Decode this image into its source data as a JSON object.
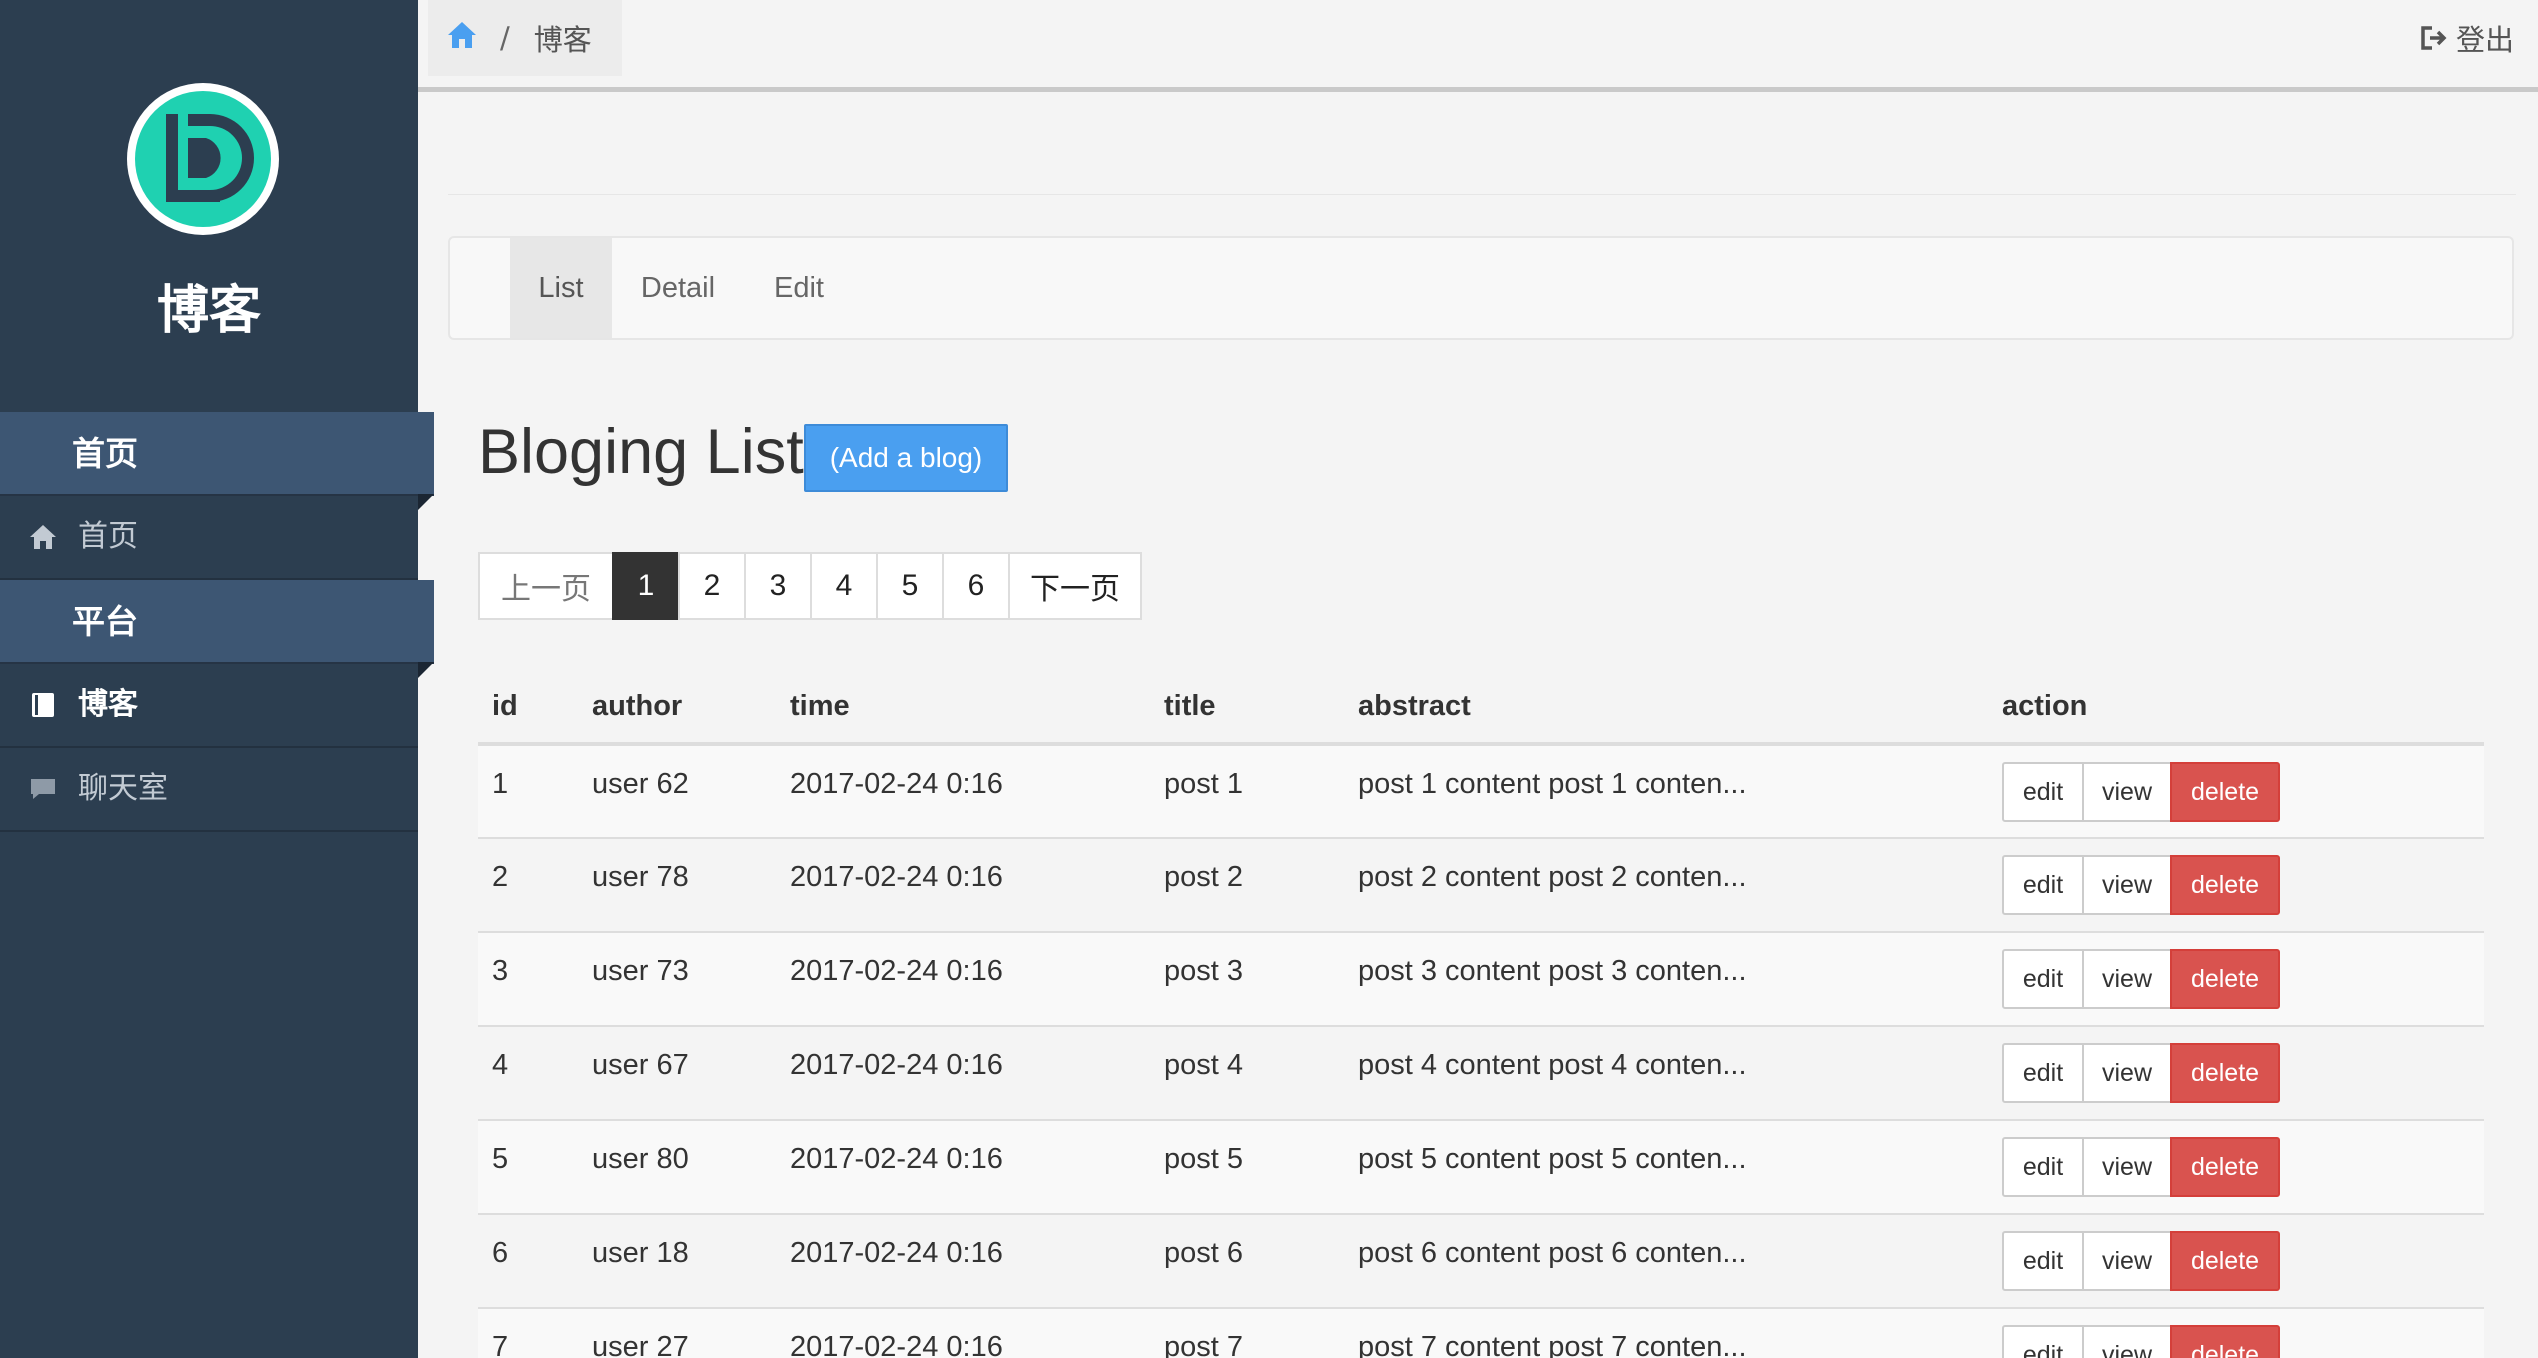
{
  "sidebar": {
    "brand": "博客",
    "sections": [
      {
        "label": "首页",
        "items": [
          {
            "label": "首页",
            "icon": "home-icon"
          }
        ]
      },
      {
        "label": "平台",
        "items": [
          {
            "label": "博客",
            "icon": "book-icon",
            "active": true
          },
          {
            "label": "聊天室",
            "icon": "chat-icon"
          }
        ]
      }
    ]
  },
  "topbar": {
    "breadcrumb_current": "博客",
    "breadcrumb_sep": "/",
    "logout_label": "登出"
  },
  "tabs": [
    "List",
    "Detail",
    "Edit"
  ],
  "page": {
    "title": "Bloging List",
    "add_button": "(Add a blog)"
  },
  "pagination": {
    "prev": "上一页",
    "pages": [
      "1",
      "2",
      "3",
      "4",
      "5",
      "6"
    ],
    "active_page": "1",
    "next": "下一页"
  },
  "table": {
    "headers": [
      "id",
      "author",
      "time",
      "title",
      "abstract",
      "action"
    ],
    "action_labels": {
      "edit": "edit",
      "view": "view",
      "delete": "delete"
    },
    "rows": [
      {
        "id": "1",
        "author": "user 62",
        "time": "2017-02-24 0:16",
        "title": "post 1",
        "abstract": "post 1 content post 1 conten..."
      },
      {
        "id": "2",
        "author": "user 78",
        "time": "2017-02-24 0:16",
        "title": "post 2",
        "abstract": "post 2 content post 2 conten..."
      },
      {
        "id": "3",
        "author": "user 73",
        "time": "2017-02-24 0:16",
        "title": "post 3",
        "abstract": "post 3 content post 3 conten..."
      },
      {
        "id": "4",
        "author": "user 67",
        "time": "2017-02-24 0:16",
        "title": "post 4",
        "abstract": "post 4 content post 4 conten..."
      },
      {
        "id": "5",
        "author": "user 80",
        "time": "2017-02-24 0:16",
        "title": "post 5",
        "abstract": "post 5 content post 5 conten..."
      },
      {
        "id": "6",
        "author": "user 18",
        "time": "2017-02-24 0:16",
        "title": "post 6",
        "abstract": "post 6 content post 6 conten..."
      },
      {
        "id": "7",
        "author": "user 27",
        "time": "2017-02-24 0:16",
        "title": "post 7",
        "abstract": "post 7 content post 7 conten..."
      }
    ]
  },
  "colors": {
    "sidebar_bg": "#2c3e50",
    "section_bg": "#3d5673",
    "logo_accent": "#1fd1b1",
    "primary": "#4a9ff0",
    "danger": "#d9534f"
  }
}
